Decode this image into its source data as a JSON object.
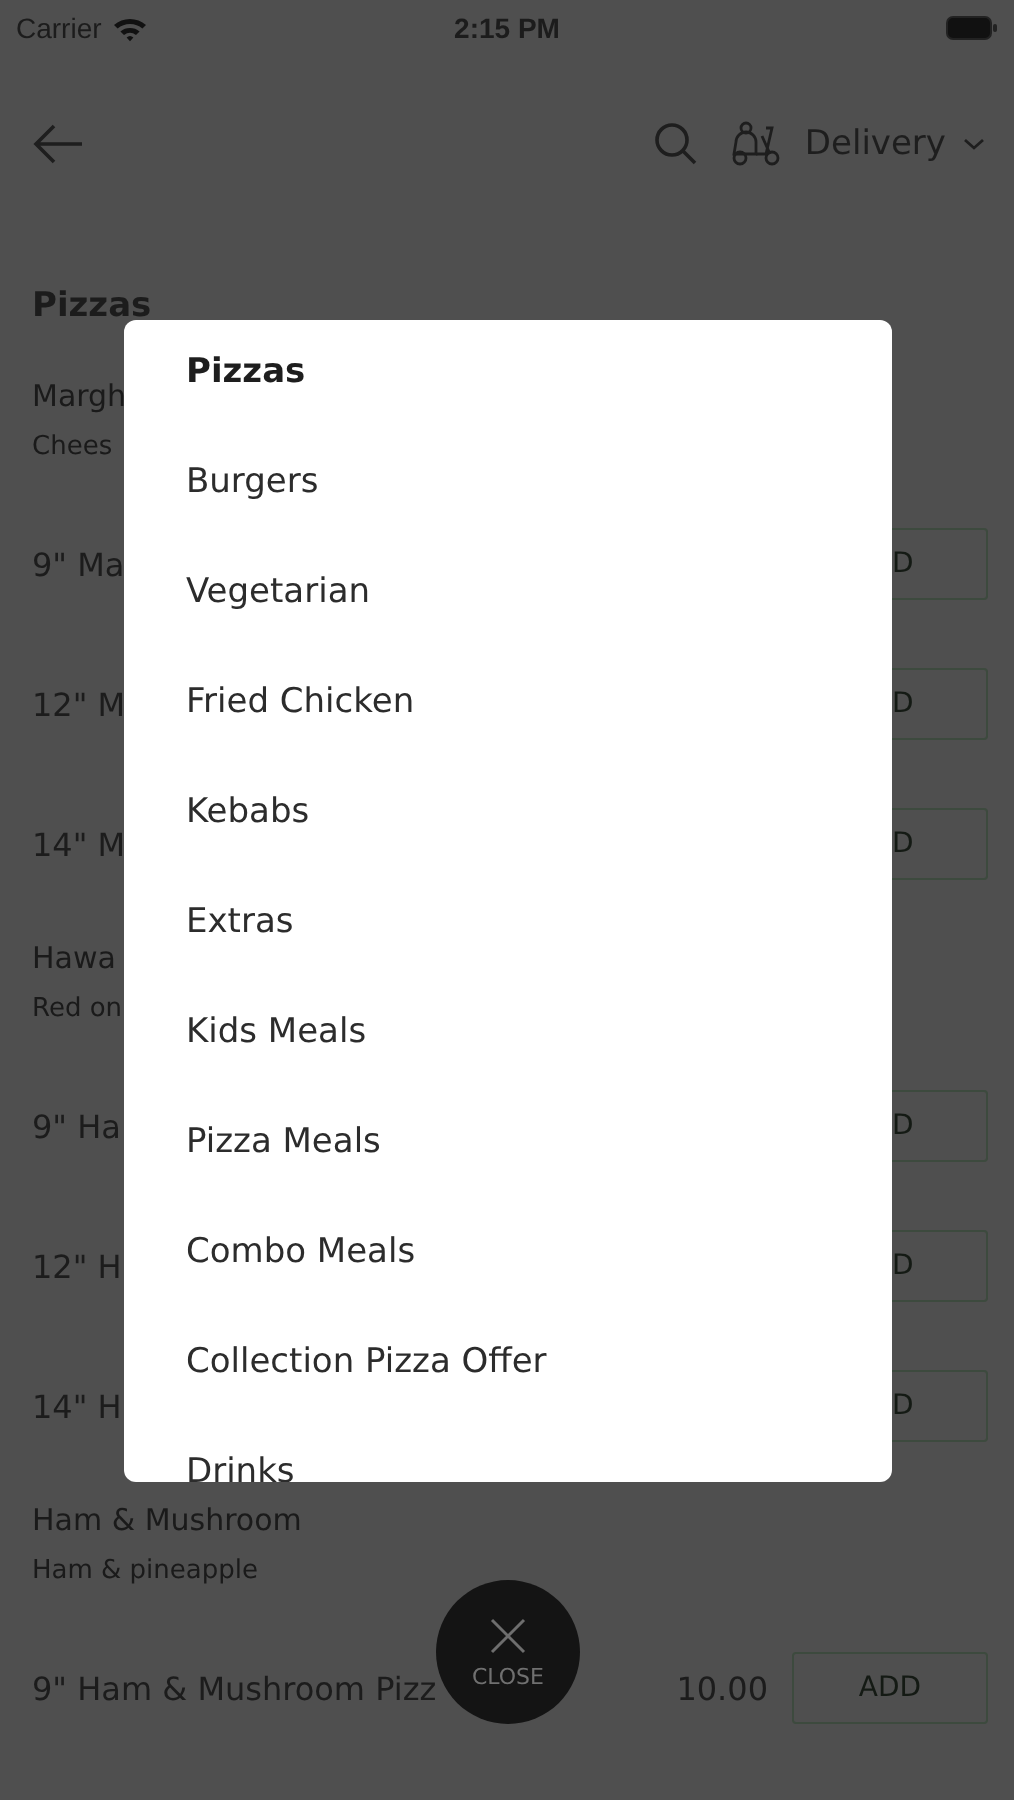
{
  "status_bar": {
    "carrier": "Carrier",
    "time": "2:15 PM"
  },
  "header": {
    "delivery_mode": "Delivery"
  },
  "menu": {
    "section_title": "Pizzas",
    "items": [
      {
        "kind": "group",
        "name": "Margh",
        "description": "Chees"
      },
      {
        "kind": "product",
        "name": "9\" Ma",
        "button": "D"
      },
      {
        "kind": "product",
        "name": "12\" M",
        "button": "D"
      },
      {
        "kind": "product",
        "name": "14\" M",
        "button": "D"
      },
      {
        "kind": "group",
        "name": "Hawa",
        "description": "Red on"
      },
      {
        "kind": "product",
        "name": "9\" Ha",
        "button": "D"
      },
      {
        "kind": "product",
        "name": "12\" H",
        "button": "D"
      },
      {
        "kind": "product",
        "name": "14\" H",
        "button": "D"
      },
      {
        "kind": "group",
        "name": "Ham & Mushroom",
        "description": "Ham & pineapple"
      },
      {
        "kind": "product",
        "name": "9\" Ham & Mushroom Pizz",
        "price": "10.00",
        "button": "ADD"
      }
    ]
  },
  "category_picker": {
    "categories": [
      {
        "label": "Pizzas",
        "selected": true
      },
      {
        "label": "Burgers",
        "selected": false
      },
      {
        "label": "Vegetarian",
        "selected": false
      },
      {
        "label": "Fried Chicken",
        "selected": false
      },
      {
        "label": "Kebabs",
        "selected": false
      },
      {
        "label": "Extras",
        "selected": false
      },
      {
        "label": "Kids Meals",
        "selected": false
      },
      {
        "label": "Pizza Meals",
        "selected": false
      },
      {
        "label": "Combo Meals",
        "selected": false
      },
      {
        "label": "Collection Pizza Offer",
        "selected": false
      },
      {
        "label": "Drinks",
        "selected": false
      }
    ]
  },
  "close_button": {
    "label": "CLOSE"
  }
}
